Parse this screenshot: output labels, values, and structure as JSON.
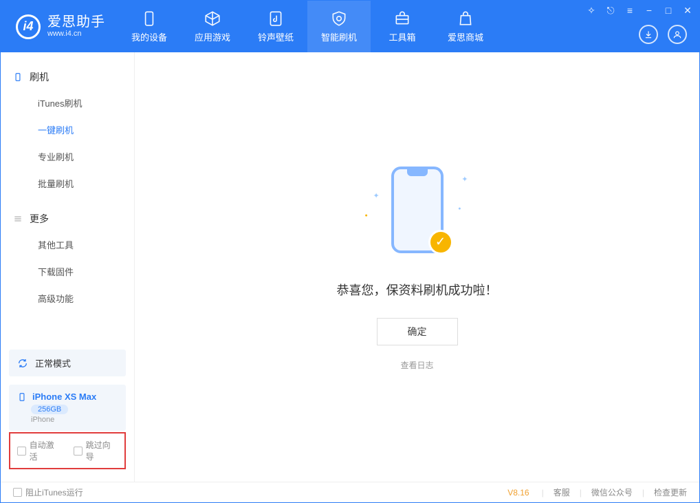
{
  "app": {
    "title": "爱思助手",
    "subtitle": "www.i4.cn"
  },
  "tabs": [
    {
      "label": "我的设备"
    },
    {
      "label": "应用游戏"
    },
    {
      "label": "铃声壁纸"
    },
    {
      "label": "智能刷机"
    },
    {
      "label": "工具箱"
    },
    {
      "label": "爱思商城"
    }
  ],
  "sidebar": {
    "section1": {
      "title": "刷机",
      "items": [
        "iTunes刷机",
        "一键刷机",
        "专业刷机",
        "批量刷机"
      ]
    },
    "section2": {
      "title": "更多",
      "items": [
        "其他工具",
        "下载固件",
        "高级功能"
      ]
    }
  },
  "device": {
    "mode": "正常模式",
    "name": "iPhone XS Max",
    "storage": "256GB",
    "type": "iPhone"
  },
  "options": {
    "auto_activate": "自动激活",
    "skip_guide": "跳过向导"
  },
  "main": {
    "success_text": "恭喜您，保资料刷机成功啦！",
    "ok": "确定",
    "view_log": "查看日志"
  },
  "footer": {
    "block_itunes": "阻止iTunes运行",
    "version": "V8.16",
    "links": [
      "客服",
      "微信公众号",
      "检查更新"
    ]
  }
}
